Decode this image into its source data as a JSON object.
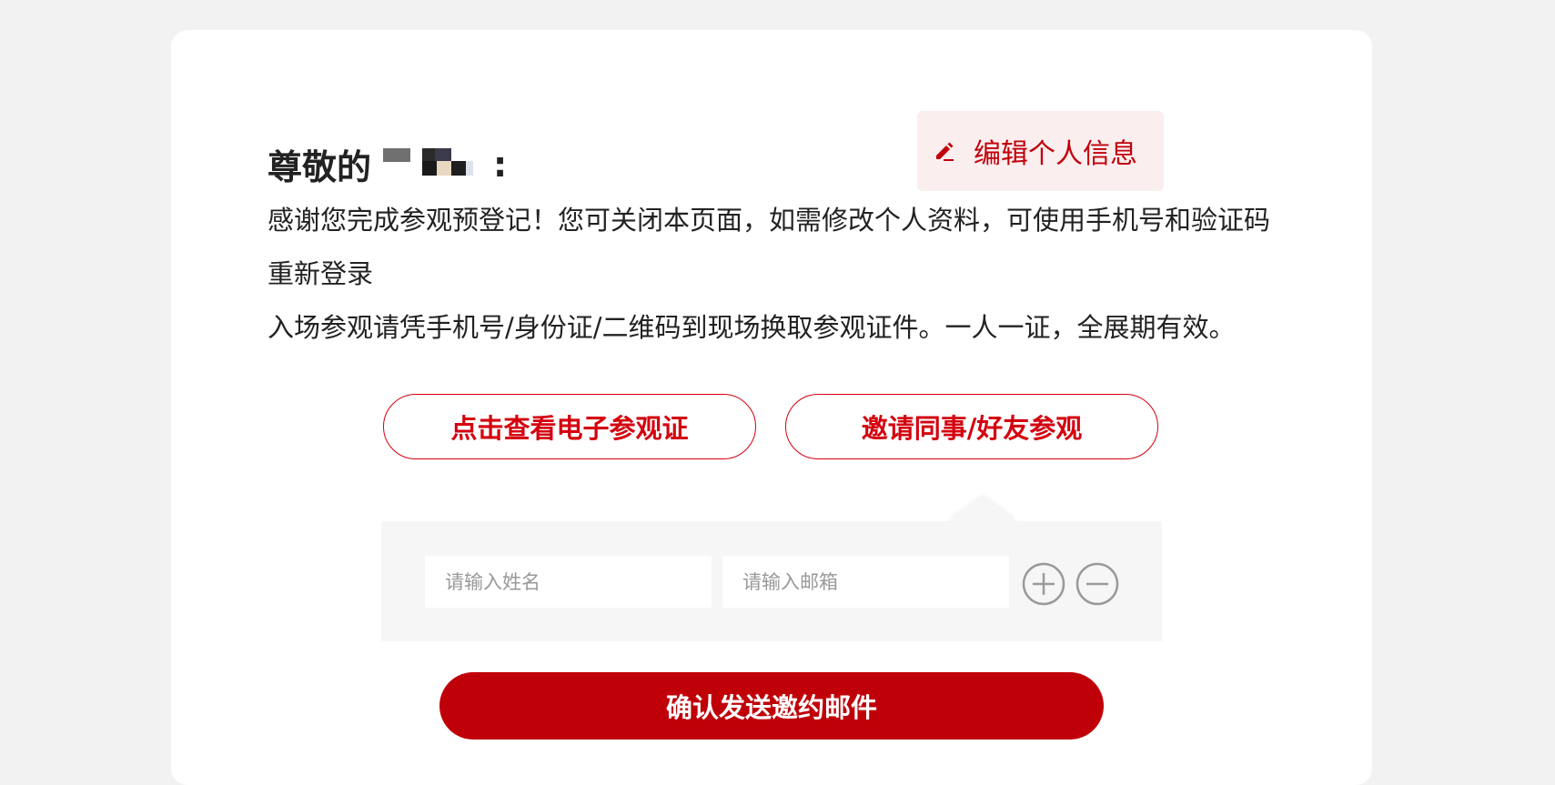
{
  "greeting": {
    "prefix": "尊敬的",
    "suffix": ":"
  },
  "edit_profile": {
    "label": "编辑个人信息",
    "icon": "pencil-icon"
  },
  "message": {
    "line1": "感谢您完成参观预登记！您可关闭本页面，如需修改个人资料，可使用手机号和验证码重新登录",
    "line2": "入场参观请凭手机号/身份证/二维码到现场换取参观证件。一人一证，全展期有效。"
  },
  "buttons": {
    "view_badge": "点击查看电子参观证",
    "invite": "邀请同事/好友参观",
    "confirm": "确认发送邀约邮件"
  },
  "invite_form": {
    "name_placeholder": "请输入姓名",
    "email_placeholder": "请输入邮箱",
    "add_icon": "plus-circle-icon",
    "remove_icon": "minus-circle-icon"
  },
  "colors": {
    "accent": "#d4000f",
    "confirm_bg": "#bf0008",
    "edit_bg": "#fbeeee",
    "page_bg": "#f2f2f2",
    "panel_bg": "#f6f6f6"
  }
}
